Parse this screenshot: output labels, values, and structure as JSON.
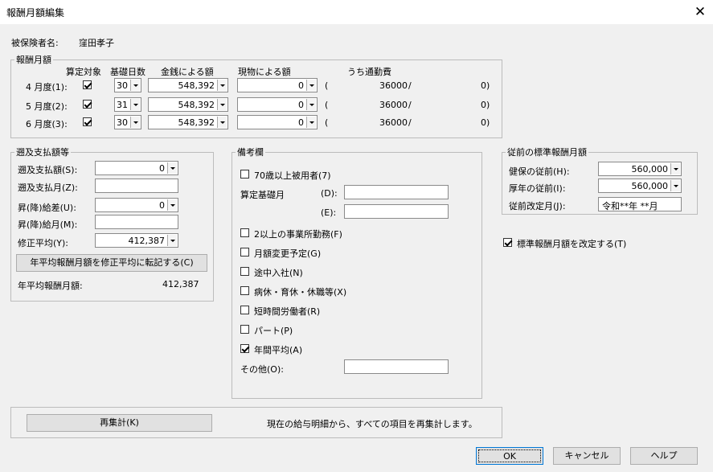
{
  "window": {
    "title": "報酬月額編集",
    "close_glyph": "✕"
  },
  "insured": {
    "label": "被保険者名:",
    "name": "窪田孝子"
  },
  "monthly": {
    "legend": "報酬月額",
    "headers": {
      "calc": "算定対象",
      "days": "基礎日数",
      "money": "金銭による額",
      "goods": "現物による額",
      "commute": "うち通勤費"
    },
    "rows": [
      {
        "month": "4 月度(1):",
        "checked": true,
        "days": "30",
        "money": "548,392",
        "goods": "0",
        "paren": "(",
        "commute": "36000",
        "slash": "/",
        "tail": "0)"
      },
      {
        "month": "5 月度(2):",
        "checked": true,
        "days": "31",
        "money": "548,392",
        "goods": "0",
        "paren": "(",
        "commute": "36000",
        "slash": "/",
        "tail": "0)"
      },
      {
        "month": "6 月度(3):",
        "checked": true,
        "days": "30",
        "money": "548,392",
        "goods": "0",
        "paren": "(",
        "commute": "36000",
        "slash": "/",
        "tail": "0)"
      }
    ]
  },
  "retro": {
    "legend": "遡及支払額等",
    "retro_amount_label": "遡及支払額(S):",
    "retro_amount": "0",
    "retro_month_label": "遡及支払月(Z):",
    "retro_month": "",
    "diff_label": "昇(降)給差(U):",
    "diff": "0",
    "raise_month_label": "昇(降)給月(M):",
    "raise_month": "",
    "adjusted_avg_label": "修正平均(Y):",
    "adjusted_avg": "412,387",
    "transfer_button": "年平均報酬月額を修正平均に転記する(C)",
    "annual_avg_label": "年平均報酬月額:",
    "annual_avg": "412,387"
  },
  "remarks": {
    "legend": "備考欄",
    "over70": "70歳以上被用者(7)",
    "base_month_label": "算定基礎月",
    "d_label": "(D):",
    "d_value": "",
    "e_label": "(E):",
    "e_value": "",
    "multi_office": "2以上の事業所勤務(F)",
    "change_planned": "月額変更予定(G)",
    "mid_join": "途中入社(N)",
    "leave": "病休・育休・休職等(X)",
    "short_time": "短時間労働者(R)",
    "part": "パート(P)",
    "annual_avg": "年間平均(A)",
    "annual_avg_checked": true,
    "other_label": "その他(O):",
    "other_value": ""
  },
  "previous": {
    "legend": "従前の標準報酬月額",
    "health_label": "健保の従前(H):",
    "health": "560,000",
    "pension_label": "厚年の従前(I):",
    "pension": "560,000",
    "revised_label": "従前改定月(J):",
    "revised": "令和**年 **月"
  },
  "revise_standard": {
    "label": "標準報酬月額を改定する(T)",
    "checked": true
  },
  "recalc": {
    "button": "再集計(K)",
    "desc": "現在の給与明細から、すべての項目を再集計します。"
  },
  "footer": {
    "ok": "OK",
    "cancel": "キャンセル",
    "help": "ヘルプ"
  }
}
